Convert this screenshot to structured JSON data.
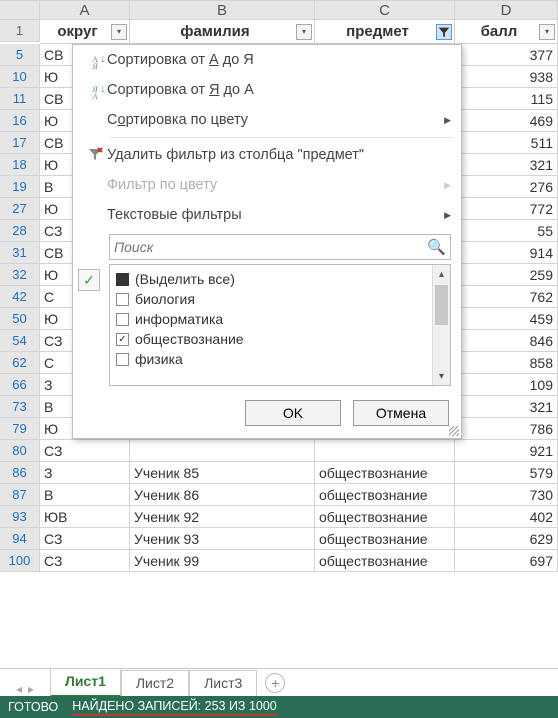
{
  "columns": {
    "rowhead": "",
    "A": "A",
    "B": "B",
    "C": "C",
    "D": "D"
  },
  "headers": {
    "okrug": "округ",
    "familia": "фамилия",
    "predmet": "предмет",
    "ball": "балл",
    "row": "1"
  },
  "rows_top": [
    {
      "n": "5",
      "a": "СВ",
      "d": "377"
    },
    {
      "n": "10",
      "a": "Ю",
      "d": "938"
    },
    {
      "n": "11",
      "a": "СВ",
      "d": "115"
    },
    {
      "n": "16",
      "a": "Ю",
      "d": "469"
    },
    {
      "n": "17",
      "a": "СВ",
      "d": "511"
    },
    {
      "n": "18",
      "a": "Ю",
      "d": "321"
    },
    {
      "n": "19",
      "a": "В",
      "d": "276"
    },
    {
      "n": "27",
      "a": "Ю",
      "d": "772"
    },
    {
      "n": "28",
      "a": "СЗ",
      "d": "55"
    },
    {
      "n": "31",
      "a": "СВ",
      "d": "914"
    },
    {
      "n": "32",
      "a": "Ю",
      "d": "259"
    },
    {
      "n": "42",
      "a": "С",
      "d": "762"
    },
    {
      "n": "50",
      "a": "Ю",
      "d": "459"
    },
    {
      "n": "54",
      "a": "СЗ",
      "d": "846"
    },
    {
      "n": "62",
      "a": "С",
      "d": "858"
    },
    {
      "n": "66",
      "a": "З",
      "d": "109"
    },
    {
      "n": "73",
      "a": "В",
      "d": "321"
    },
    {
      "n": "79",
      "a": "Ю",
      "d": "786"
    },
    {
      "n": "80",
      "a": "СЗ",
      "d": "921"
    }
  ],
  "rows_bottom": [
    {
      "n": "86",
      "a": "З",
      "b": "Ученик 85",
      "c": "обществознание",
      "d": "579"
    },
    {
      "n": "87",
      "a": "В",
      "b": "Ученик 86",
      "c": "обществознание",
      "d": "730"
    },
    {
      "n": "93",
      "a": "ЮВ",
      "b": "Ученик 92",
      "c": "обществознание",
      "d": "402"
    },
    {
      "n": "94",
      "a": "СЗ",
      "b": "Ученик 93",
      "c": "обществознание",
      "d": "629"
    },
    {
      "n": "100",
      "a": "СЗ",
      "b": "Ученик 99",
      "c": "обществознание",
      "d": "697"
    }
  ],
  "menu": {
    "sort_az_pre": "Сортировка от ",
    "sort_az_a": "А",
    "sort_az_mid": " до ",
    "sort_az_z": "Я",
    "sort_za_pre": "Сортировка от ",
    "sort_za_a": "Я",
    "sort_za_mid": " до ",
    "sort_za_z": "А",
    "sort_color_pre": "С",
    "sort_color_ul": "о",
    "sort_color_rest": "ртировка по цвету",
    "clear_filter": "Удалить фильтр из столбца \"предмет\"",
    "filter_color": "Фильтр по цвету",
    "text_filters": "Текстовые фильтры",
    "search_placeholder": "Поиск",
    "select_all": "(Выделить все)",
    "opt_bio": "биология",
    "opt_inf": "информатика",
    "opt_obsh": "обществознание",
    "opt_fiz": "физика",
    "ok": "OK",
    "cancel": "Отмена"
  },
  "sheets": {
    "s1": "Лист1",
    "s2": "Лист2",
    "s3": "Лист3"
  },
  "status": {
    "ready": "ГОТОВО",
    "found": "НАЙДЕНО ЗАПИСЕЙ: 253 ИЗ 1000"
  }
}
